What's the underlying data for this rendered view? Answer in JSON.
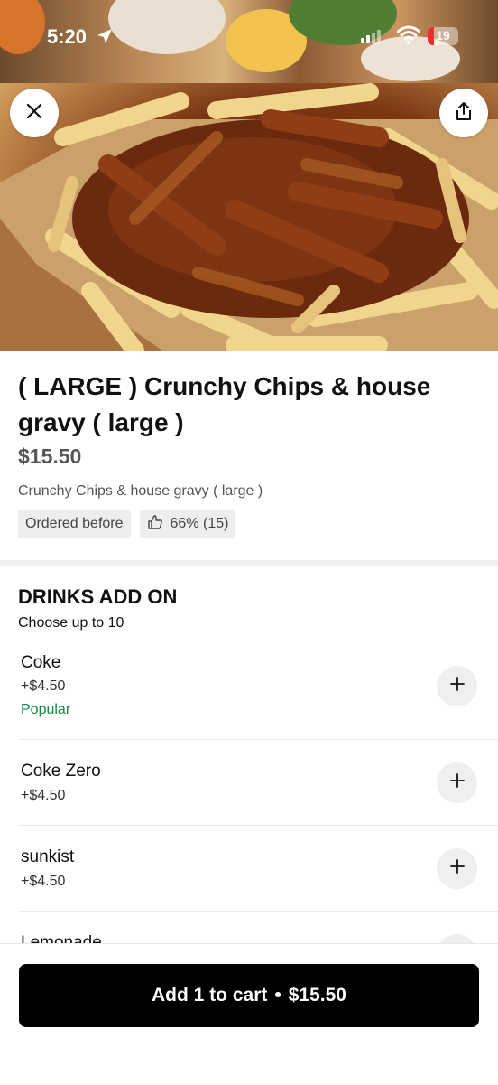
{
  "status_bar": {
    "time": "5:20",
    "battery": "19"
  },
  "product": {
    "title": "( LARGE ) Crunchy Chips & house gravy ( large )",
    "price": "$15.50",
    "description": "Crunchy Chips & house gravy ( large )",
    "tags": [
      "Ordered before",
      "66% (15)"
    ]
  },
  "addons": {
    "title": "DRINKS ADD ON",
    "subtitle": "Choose up to 10",
    "options": [
      {
        "name": "Coke",
        "price": "+$4.50",
        "badge": "Popular"
      },
      {
        "name": "Coke Zero",
        "price": "+$4.50"
      },
      {
        "name": "sunkist",
        "price": "+$4.50"
      },
      {
        "name": "Lemonade",
        "price": ""
      }
    ]
  },
  "cart": {
    "label": "Add 1 to cart",
    "separator": "•",
    "total": "$15.50"
  },
  "colors": {
    "accent_green": "#138a3d",
    "battery_low": "#e5322d",
    "button_black": "#000000"
  },
  "icons": [
    "location-arrow-icon",
    "signal-icon",
    "wifi-icon",
    "battery-icon",
    "close-icon",
    "share-icon",
    "thumbs-up-icon",
    "plus-icon"
  ]
}
